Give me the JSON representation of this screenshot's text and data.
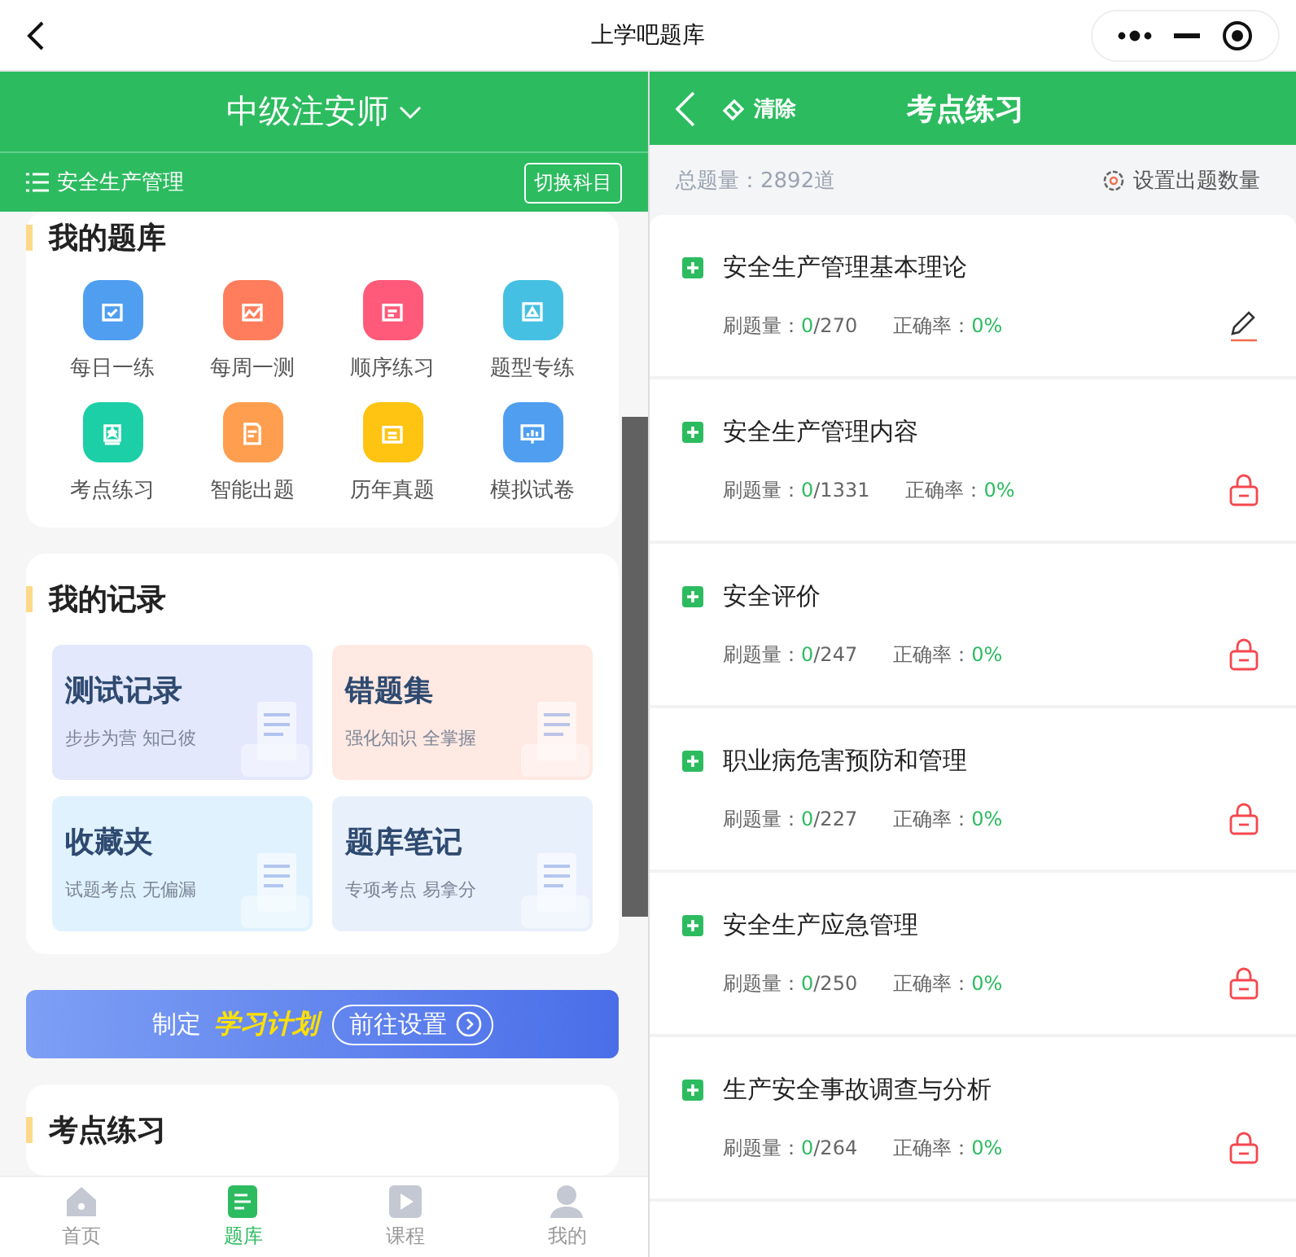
{
  "window": {
    "title": "上学吧题库"
  },
  "left": {
    "header_title": "中级注安师",
    "subject": "安全生产管理",
    "switch_button": "切换科目",
    "bank": {
      "title": "我的题库",
      "items": [
        {
          "label": "每日一练",
          "color": "#4f9ef0"
        },
        {
          "label": "每周一测",
          "color": "#ff7d5c"
        },
        {
          "label": "顺序练习",
          "color": "#ff5a7a"
        },
        {
          "label": "题型专练",
          "color": "#45c0e2"
        },
        {
          "label": "考点练习",
          "color": "#1ccfa6"
        },
        {
          "label": "智能出题",
          "color": "#ff9e4f"
        },
        {
          "label": "历年真题",
          "color": "#ffc312"
        },
        {
          "label": "模拟试卷",
          "color": "#4f9ef0"
        }
      ]
    },
    "records": {
      "title": "我的记录",
      "items": [
        {
          "title": "测试记录",
          "subtitle": "步步为营 知己彼",
          "color": "#e3e8fd"
        },
        {
          "title": "错题集",
          "subtitle": "强化知识 全掌握",
          "color": "#ffe9e2"
        },
        {
          "title": "收藏夹",
          "subtitle": "试题考点 无偏漏",
          "color": "#e0f2fe"
        },
        {
          "title": "题库笔记",
          "subtitle": "专项考点 易拿分",
          "color": "#e8f0fc"
        }
      ]
    },
    "banner": {
      "prefix": "制定",
      "highlight": "学习计划",
      "button": "前往设置"
    },
    "next_section": {
      "title": "考点练习"
    },
    "tabs": [
      {
        "label": "首页",
        "selected": false
      },
      {
        "label": "题库",
        "selected": true
      },
      {
        "label": "课程",
        "selected": false
      },
      {
        "label": "我的",
        "selected": false
      }
    ]
  },
  "right": {
    "clear": "清除",
    "title": "考点练习",
    "total": "总题量：2892道",
    "settings": "设置出题数量",
    "rows": [
      {
        "name": "安全生产管理基本理论",
        "done_label": "刷题量：",
        "done": "0",
        "total": "/270",
        "accuracy_label": "正确率：",
        "accuracy": "0%",
        "kind": "edit"
      },
      {
        "name": "安全生产管理内容",
        "done_label": "刷题量：",
        "done": "0",
        "total": "/1331",
        "accuracy_label": "正确率：",
        "accuracy": "0%",
        "kind": "locked"
      },
      {
        "name": "安全评价",
        "done_label": "刷题量：",
        "done": "0",
        "total": "/247",
        "accuracy_label": "正确率：",
        "accuracy": "0%",
        "kind": "locked"
      },
      {
        "name": "职业病危害预防和管理",
        "done_label": "刷题量：",
        "done": "0",
        "total": "/227",
        "accuracy_label": "正确率：",
        "accuracy": "0%",
        "kind": "locked"
      },
      {
        "name": "安全生产应急管理",
        "done_label": "刷题量：",
        "done": "0",
        "total": "/250",
        "accuracy_label": "正确率：",
        "accuracy": "0%",
        "kind": "locked"
      },
      {
        "name": "生产安全事故调查与分析",
        "done_label": "刷题量：",
        "done": "0",
        "total": "/264",
        "accuracy_label": "正确率：",
        "accuracy": "0%",
        "kind": "locked"
      }
    ]
  }
}
